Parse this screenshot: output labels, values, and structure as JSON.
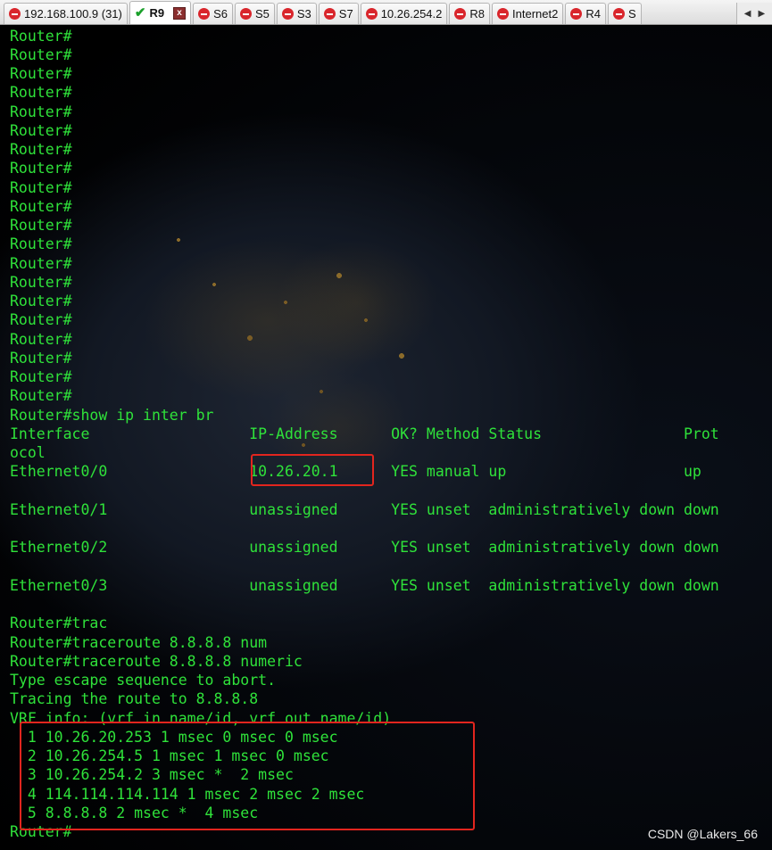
{
  "tabs": [
    {
      "label": "192.168.100.9 (31)",
      "status": "disconnected"
    },
    {
      "label": "R9",
      "status": "connected",
      "active": true
    },
    {
      "label": "S6",
      "status": "disconnected"
    },
    {
      "label": "S5",
      "status": "disconnected"
    },
    {
      "label": "S3",
      "status": "disconnected"
    },
    {
      "label": "S7",
      "status": "disconnected"
    },
    {
      "label": "10.26.254.2",
      "status": "disconnected"
    },
    {
      "label": "R8",
      "status": "disconnected"
    },
    {
      "label": "Internet2",
      "status": "disconnected"
    },
    {
      "label": "R4",
      "status": "disconnected"
    },
    {
      "label": "S",
      "status": "disconnected"
    }
  ],
  "tab_close_label": "x",
  "colors": {
    "terminal_text": "#2fe23a",
    "highlight_box": "#e2251e",
    "disconnected_dot": "#d9262c",
    "connected_check": "#1aa02a"
  },
  "terminal": {
    "lines": [
      "Router#",
      "Router#",
      "Router#",
      "Router#",
      "Router#",
      "Router#",
      "Router#",
      "Router#",
      "Router#",
      "Router#",
      "Router#",
      "Router#",
      "Router#",
      "Router#",
      "Router#",
      "Router#",
      "Router#",
      "Router#",
      "Router#",
      "Router#",
      "Router#show ip inter br",
      "Interface                  IP-Address      OK? Method Status                Prot",
      "ocol",
      "Ethernet0/0                10.26.20.1      YES manual up                    up",
      "",
      "Ethernet0/1                unassigned      YES unset  administratively down down",
      "",
      "Ethernet0/2                unassigned      YES unset  administratively down down",
      "",
      "Ethernet0/3                unassigned      YES unset  administratively down down",
      "",
      "Router#trac",
      "Router#traceroute 8.8.8.8 num",
      "Router#traceroute 8.8.8.8 numeric",
      "Type escape sequence to abort.",
      "Tracing the route to 8.8.8.8",
      "VRF info: (vrf in name/id, vrf out name/id)",
      "  1 10.26.20.253 1 msec 0 msec 0 msec",
      "  2 10.26.254.5 1 msec 1 msec 0 msec",
      "  3 10.26.254.2 3 msec *  2 msec",
      "  4 114.114.114.114 1 msec 2 msec 2 msec",
      "  5 8.8.8.8 2 msec *  4 msec",
      "Router#"
    ]
  },
  "watermark": "CSDN @Lakers_66"
}
